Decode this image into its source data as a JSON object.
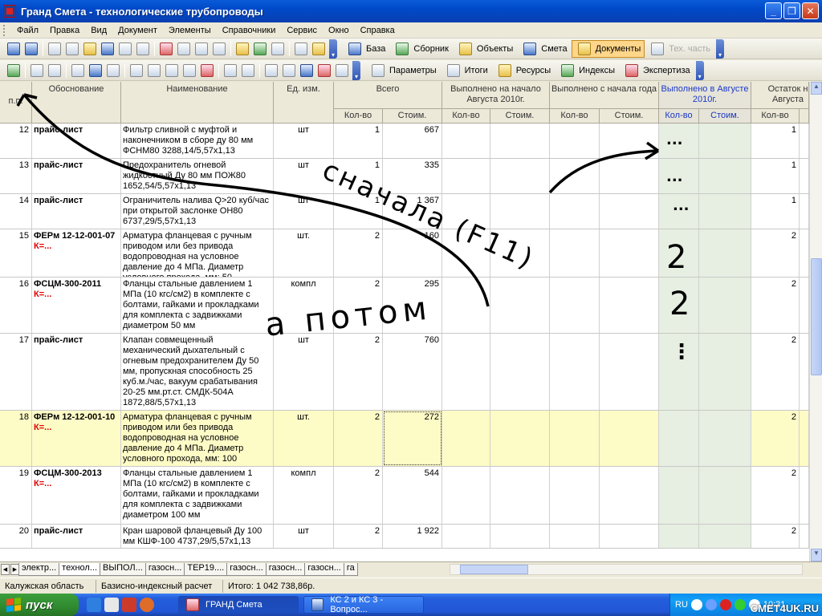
{
  "window": {
    "title": "Гранд Смета - технологические трубопроводы",
    "min": "_",
    "max": "❐",
    "close": "✕"
  },
  "menu": [
    "Файл",
    "Правка",
    "Вид",
    "Документ",
    "Элементы",
    "Справочники",
    "Сервис",
    "Окно",
    "Справка"
  ],
  "toolbar2": {
    "baza": "База",
    "sbornik": "Сборник",
    "obekty": "Объекты",
    "smeta": "Смета",
    "dokumenty": "Документы",
    "teh": "Тех. часть"
  },
  "toolbar3": {
    "parametry": "Параметры",
    "itogi": "Итоги",
    "resursy": "Ресурсы",
    "indeksy": "Индексы",
    "ekspertiza": "Экспертиза"
  },
  "columns": {
    "pp": "п.п.",
    "obosnovanie": "Обоснование",
    "naimenovanie": "Наименование",
    "ed": "Ед. изм.",
    "vsego": "Всего",
    "vyp_nachalo": "Выполнено на начало Августа 2010г.",
    "vyp_s_nachala": "Выполнено с начала года",
    "vyp_v": "Выполнено в Августе 2010г.",
    "ostatok": "Остаток н Августа",
    "kolvo": "Кол-во",
    "stoim": "Стоим."
  },
  "rows": [
    {
      "n": "12",
      "basis": "прайс-лист",
      "k": "",
      "name": "Фильтр сливной с муфтой и наконечником в сборе ду 80 мм ФСНМ80   3288,14/5,57х1,13",
      "unit": "шт",
      "qty": "1",
      "cost": "667",
      "rem": "1"
    },
    {
      "n": "13",
      "basis": "прайс-лист",
      "k": "",
      "name": "Предохранитель огневой жидкостный Ду 80 мм ПОЖ80   1652,54/5,57х1,13",
      "unit": "шт",
      "qty": "1",
      "cost": "335",
      "rem": "1"
    },
    {
      "n": "14",
      "basis": "прайс-лист",
      "k": "",
      "name": "Ограничитель налива Q>20 куб/час при открытой заслонке ОН80   6737,29/5,57х1,13",
      "unit": "шт",
      "qty": "1",
      "cost": "1 367",
      "rem": "1"
    },
    {
      "n": "15",
      "basis": "ФЕРм 12-12-001-07",
      "k": "К=...",
      "name": "Арматура фланцевая с ручным приводом или без привода водопроводная на условное давление до 4 МПа. Диаметр условного прохода, мм: 50",
      "unit": "шт.",
      "qty": "2",
      "cost": "160",
      "rem": "2"
    },
    {
      "n": "16",
      "basis": "ФСЦМ-300-2011",
      "k": "К=...",
      "name": "Фланцы стальные давлением 1 МПа (10 кгс/см2) в комплекте с болтами, гайками и прокладками для комплекта с задвижками диаметром 50 мм",
      "unit": "компл",
      "qty": "2",
      "cost": "295",
      "rem": "2"
    },
    {
      "n": "17",
      "basis": "прайс-лист",
      "k": "",
      "name": "Клапан совмещенный механический дыхательный с огневым предохранителем Ду 50 мм, пропускная способность 25 куб.м./час, вакуум срабатывания 20-25 мм.рт.ст. СМДК-504А 1872,88/5,57х1,13",
      "unit": "шт",
      "qty": "2",
      "cost": "760",
      "rem": "2"
    },
    {
      "n": "18",
      "basis": "ФЕРм 12-12-001-10",
      "k": "К=...",
      "name": "Арматура фланцевая с ручным приводом или без привода водопроводная на условное давление до 4 МПа. Диаметр условного прохода, мм: 100",
      "unit": "шт.",
      "qty": "2",
      "cost": "272",
      "rem": "2"
    },
    {
      "n": "19",
      "basis": "ФСЦМ-300-2013",
      "k": "К=...",
      "name": "Фланцы стальные давлением 1 МПа (10 кгс/см2) в комплекте с болтами, гайками и прокладками для комплекта с задвижками диаметром 100 мм",
      "unit": "компл",
      "qty": "2",
      "cost": "544",
      "rem": "2"
    },
    {
      "n": "20",
      "basis": "прайс-лист",
      "k": "",
      "name": "Кран шаровой фланцевый Ду 100 мм КШФ-100   4737,29/5,57х1,13",
      "unit": "шт",
      "qty": "2",
      "cost": "1 922",
      "rem": "2"
    }
  ],
  "sheets": [
    "электр...",
    "технол...",
    "ВЫПОЛ...",
    "газосн...",
    "ТЕР19....",
    "газосн...",
    "газосн...",
    "газосн...",
    "га"
  ],
  "status": {
    "region": "Калужская область",
    "method": "Базисно-индексный расчет",
    "total": "Итого: 1 042 738,86р."
  },
  "taskbar": {
    "start": "пуск",
    "task1": "ГРАНД Смета",
    "task2": "КС 2 и КС 3 - Вопрос...",
    "lang": "RU",
    "clock": "10:31",
    "watermark": "CMET4UK.RU"
  },
  "scribble": {
    "first": "сначала (F11)",
    "then": "а потом",
    "col_vals": [
      "...",
      "...",
      "...",
      "2",
      "2",
      "⋮"
    ]
  }
}
